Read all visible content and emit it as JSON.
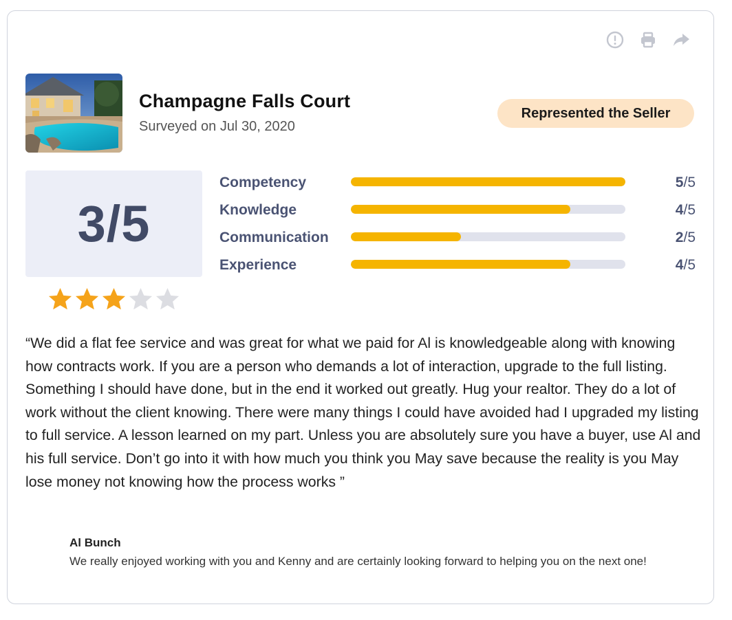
{
  "property": {
    "name": "Champagne Falls Court",
    "surveyed": "Surveyed on Jul 30, 2020",
    "badge": "Represented the Seller"
  },
  "actions": [
    "report-icon",
    "print-icon",
    "share-icon"
  ],
  "rating": {
    "overall_text": "3/5",
    "overall_value": 3,
    "out_of": 5,
    "star_filled_color": "#f5a31a",
    "star_empty_color": "#dcdde2"
  },
  "categories": [
    {
      "label": "Competency",
      "score": "5",
      "of": "/5",
      "value": 5
    },
    {
      "label": "Knowledge",
      "score": "4",
      "of": "/5",
      "value": 4
    },
    {
      "label": "Communication",
      "score": "2",
      "of": "/5",
      "value": 2
    },
    {
      "label": "Experience",
      "score": "4",
      "of": "/5",
      "value": 4
    }
  ],
  "colors": {
    "bar_fill": "#f5b400",
    "bar_track": "#e0e2ec",
    "label": "#4a5373",
    "badge_bg": "#fde4c6"
  },
  "review": {
    "text": "“We did a flat fee service and was great for what we paid for Al is knowledgeable along with knowing how contracts work. If you are a person who demands a lot of interaction, upgrade to the full listing. Something I should have done, but in the end it worked out greatly. Hug your realtor. They do a lot of work without the client knowing. There were many things I could have avoided had I upgraded my listing to full service. A lesson learned on my part. Unless you are absolutely sure you have a buyer, use Al and his full service. Don’t go into it with how much you think you May save because the reality is you May lose money not knowing how the process works ”"
  },
  "reply": {
    "name": "Al Bunch",
    "text": "We really enjoyed working with you and Kenny and are certainly looking forward to helping you on the next one!"
  }
}
